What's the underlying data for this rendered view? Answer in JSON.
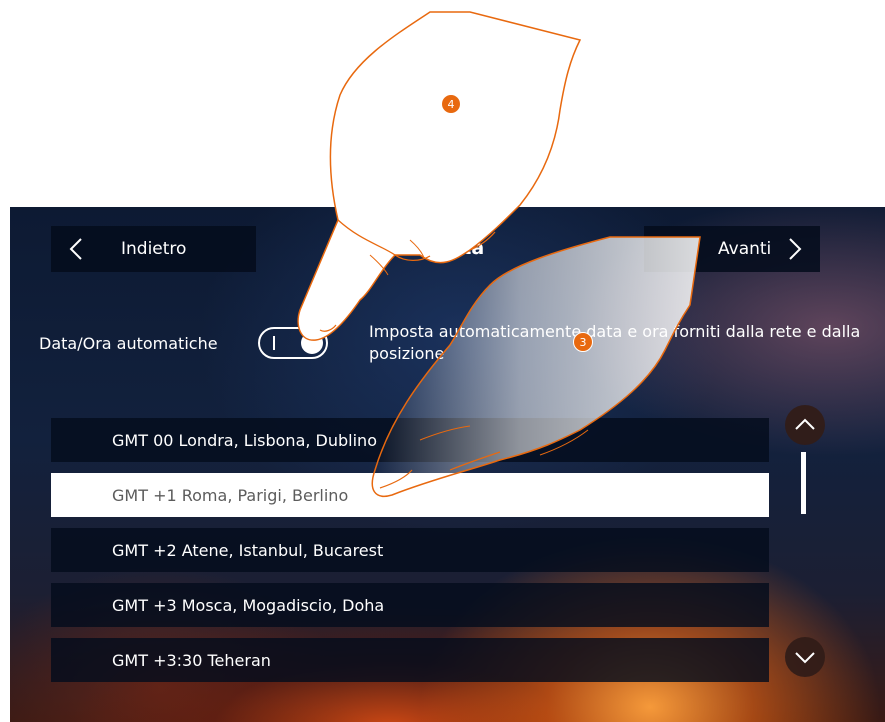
{
  "header": {
    "back_label": "Indietro",
    "title": "data",
    "next_label": "Avanti"
  },
  "auto_time": {
    "label": "Data/Ora automatiche",
    "toggle_state": "on",
    "description": "Imposta automaticamente data e ora forniti dalla rete e dalla posizione"
  },
  "timezones": {
    "items": [
      {
        "label": "GMT 00 Londra, Lisbona, Dublino",
        "selected": false
      },
      {
        "label": "GMT +1 Roma, Parigi, Berlino",
        "selected": true
      },
      {
        "label": "GMT +2 Atene, Istanbul, Bucarest",
        "selected": false
      },
      {
        "label": "GMT +3 Mosca, Mogadiscio, Doha",
        "selected": false
      },
      {
        "label": "GMT +3:30 Teheran",
        "selected": false
      }
    ]
  },
  "annotations": {
    "step_3": "3",
    "step_4": "4"
  },
  "colors": {
    "badge": "#e8690f",
    "hand_outline": "#e8690f",
    "button_bg": "#040c1c",
    "selected_row_bg": "#ffffff"
  },
  "icons": {
    "back": "chevron-left-icon",
    "next": "chevron-right-icon",
    "scroll_up": "chevron-up-icon",
    "scroll_down": "chevron-down-icon"
  }
}
